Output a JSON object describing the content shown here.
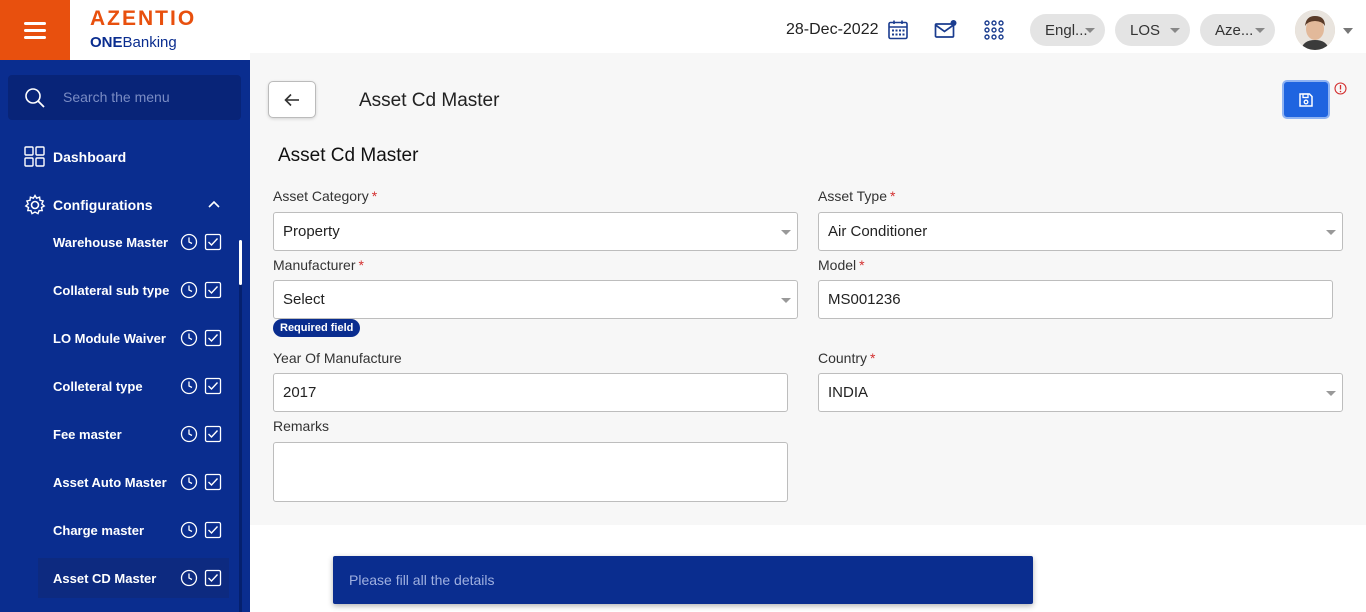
{
  "header": {
    "brand": "AZENTIO",
    "sub_bold": "ONE",
    "sub_regular": "Banking",
    "date": "28-Dec-2022",
    "language": "Engl...",
    "module": "LOS",
    "entity": "Aze..."
  },
  "sidebar": {
    "search_placeholder": "Search the menu",
    "dashboard": "Dashboard",
    "configurations": "Configurations",
    "items": [
      {
        "label": "Warehouse Master"
      },
      {
        "label": "Collateral sub type"
      },
      {
        "label": "LO Module Waiver"
      },
      {
        "label": "Colleteral type"
      },
      {
        "label": "Fee master"
      },
      {
        "label": "Asset Auto Master"
      },
      {
        "label": "Charge master"
      },
      {
        "label": "Asset CD Master"
      }
    ]
  },
  "main": {
    "page_title": "Asset Cd Master",
    "form_title": "Asset Cd Master",
    "fields": {
      "asset_category": {
        "label": "Asset Category",
        "value": "Property"
      },
      "asset_type": {
        "label": "Asset Type",
        "value": "Air Conditioner"
      },
      "manufacturer": {
        "label": "Manufacturer",
        "value": "Select",
        "error": "Required field"
      },
      "model": {
        "label": "Model",
        "value": "MS001236"
      },
      "year": {
        "label": "Year Of Manufacture",
        "value": "2017"
      },
      "country": {
        "label": "Country",
        "value": "INDIA"
      },
      "remarks": {
        "label": "Remarks",
        "value": ""
      }
    },
    "required_mark": "*"
  },
  "toast": {
    "message": "Please fill all the details"
  },
  "colors": {
    "accent_orange": "#e8500e",
    "navy": "#0a2d8f",
    "save_blue": "#1f64e0",
    "required_red": "#d32f2f"
  },
  "icons": [
    "menu-icon",
    "calendar-icon",
    "mail-icon",
    "apps-grid-icon",
    "search-icon",
    "dashboard-icon",
    "gear-icon",
    "chevron-up-icon",
    "history-icon",
    "checkbox-icon",
    "arrow-left-icon",
    "save-icon",
    "error-icon"
  ]
}
